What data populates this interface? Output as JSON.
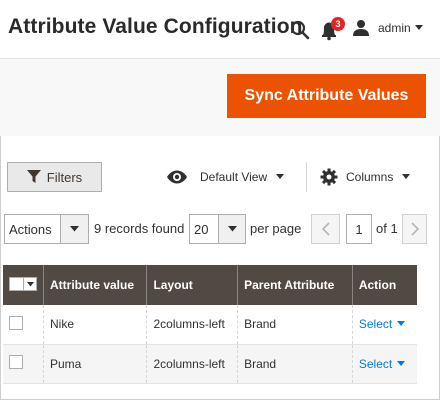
{
  "header": {
    "title": "Attribute Value Configuration",
    "notification_count": "3",
    "user_name": "admin"
  },
  "page_actions": {
    "sync_label": "Sync Attribute Values"
  },
  "toolbar": {
    "filters_label": "Filters",
    "view_label": "Default View",
    "columns_label": "Columns",
    "actions_label": "Actions",
    "records_text": "9 records found",
    "per_page_value": "20",
    "per_page_label": "per page",
    "current_page": "1",
    "of_total": "of 1"
  },
  "grid": {
    "columns": [
      "Attribute value",
      "Layout",
      "Parent Attribute",
      "Action"
    ],
    "rows": [
      {
        "attribute_value": "Nike",
        "layout": "2columns-left",
        "parent_attribute": "Brand",
        "action": "Select"
      },
      {
        "attribute_value": "Puma",
        "layout": "2columns-left",
        "parent_attribute": "Brand",
        "action": "Select"
      }
    ]
  },
  "colors": {
    "accent": "#eb5202",
    "header_bg": "#514943",
    "link": "#007bdb",
    "badge": "#e22626"
  },
  "icons": [
    "search-icon",
    "bell-icon",
    "user-icon",
    "filter-icon",
    "eye-icon",
    "gear-icon",
    "chevron-left-icon",
    "chevron-right-icon"
  ]
}
